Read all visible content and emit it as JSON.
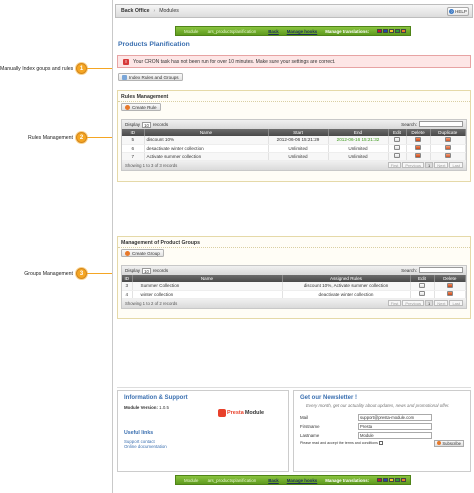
{
  "callouts": [
    {
      "num": "1",
      "text": "Manually Index goups and rules"
    },
    {
      "num": "2",
      "text": "Rules Management"
    },
    {
      "num": "3",
      "text": "Groups Management"
    }
  ],
  "topbar": {
    "crumb1": "Back Office",
    "separator": "›",
    "crumb2": "Modules",
    "help": "HELP"
  },
  "greenbar": {
    "module_label": "Module",
    "module_name": "ars_productsplanification",
    "back": "Back",
    "manage_hooks": "Manage hooks",
    "manage_translations": "Manage translations:",
    "flags": [
      "#c8102e",
      "#1f4aa8",
      "#f4c430",
      "#2a9a3c",
      "#e8792a"
    ]
  },
  "page_title": "Products Planification",
  "error": {
    "icon": "!",
    "text": "Your CRON task has not been run for over 10 minutes. Make sure your settings are correct."
  },
  "index_button": "Index Rules and Groups",
  "rules": {
    "title": "Rules Management",
    "create": "Create Rule",
    "display": "Display",
    "display_count": "10",
    "records": "records",
    "search": "Search:",
    "columns": [
      "ID",
      "Name",
      "Start",
      "End",
      "Edit",
      "Delete",
      "Duplicate"
    ],
    "rows": [
      {
        "id": "5",
        "name": "discount 10%",
        "start": "2012-06-06 15:21:29",
        "end": "2012-06-16 15:21:32"
      },
      {
        "id": "6",
        "name": "desactivate winter collection",
        "start": "Unlimited",
        "end": "Unlimited"
      },
      {
        "id": "7",
        "name": "Activate summer collection",
        "start": "Unlimited",
        "end": "Unlimited"
      }
    ],
    "footer": "Showing 1 to 3 of 3 records",
    "pager": [
      "First",
      "Previous",
      "1",
      "Next",
      "Last"
    ]
  },
  "groups": {
    "title": "Management of Product Groups",
    "create": "Create Group",
    "display": "Display",
    "display_count": "10",
    "records": "records",
    "search": "Search:",
    "columns": [
      "ID",
      "Name",
      "Assigned Rules",
      "Edit",
      "Delete"
    ],
    "rows": [
      {
        "id": "3",
        "name": "Summer Collection",
        "rules": "discount 10%, Activate summer collection"
      },
      {
        "id": "4",
        "name": "winter collection",
        "rules": "deactivate winter collection"
      }
    ],
    "footer": "Showing 1 to 2 of 2 records",
    "pager": [
      "First",
      "Previous",
      "1",
      "Next",
      "Last"
    ]
  },
  "info": {
    "title": "Information & Support",
    "module_version_label": "Module Version:",
    "module_version": "1.0.5",
    "logo_part1": "Presta",
    "logo_part2": "Module",
    "useful_links": "Useful links",
    "support_contact": "Support contact",
    "online_doc": "Online documentation"
  },
  "newsletter": {
    "title": "Get our Newsletter !",
    "quote": "Every month, get our actuality about updates, news and promotional offer.",
    "mail_label": "Mail",
    "mail_value": "support@presta-module.com",
    "firstname_label": "Firstname",
    "firstname_value": "Presta",
    "lastname_label": "Lastname",
    "lastname_value": "Module",
    "terms": "Please read and accept the terms and conditions",
    "subscribe": "Subscribe"
  }
}
